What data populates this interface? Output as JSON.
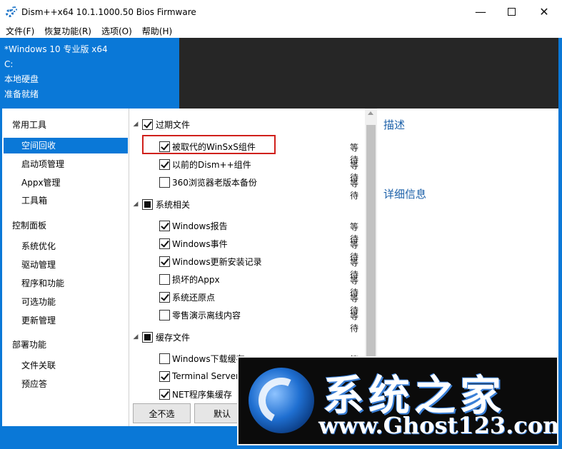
{
  "window": {
    "title": "Dism++x64 10.1.1000.50 Bios Firmware"
  },
  "menu": [
    "文件(F)",
    "恢复功能(R)",
    "选项(O)",
    "帮助(H)"
  ],
  "info": {
    "os": "*Windows 10 专业版 x64",
    "drive": "C:",
    "disk": "本地硬盘",
    "status": "准备就绪"
  },
  "sidebar": {
    "sections": [
      {
        "title": "常用工具",
        "items": [
          "空间回收",
          "启动项管理",
          "Appx管理",
          "工具箱"
        ]
      },
      {
        "title": "控制面板",
        "items": [
          "系统优化",
          "驱动管理",
          "程序和功能",
          "可选功能",
          "更新管理"
        ]
      },
      {
        "title": "部署功能",
        "items": [
          "文件关联",
          "预应答"
        ]
      }
    ],
    "selected": "空间回收"
  },
  "list": {
    "groups": [
      {
        "label": "过期文件",
        "state": "checked",
        "items": [
          {
            "label": "被取代的WinSxS组件",
            "checked": true,
            "status": "等待"
          },
          {
            "label": "以前的Dism++组件",
            "checked": true,
            "status": "等待"
          },
          {
            "label": "360浏览器老版本备份",
            "checked": false,
            "status": "等待"
          }
        ]
      },
      {
        "label": "系统相关",
        "state": "partial",
        "items": [
          {
            "label": "Windows报告",
            "checked": true,
            "status": "等待"
          },
          {
            "label": "Windows事件",
            "checked": true,
            "status": "等待"
          },
          {
            "label": "Windows更新安装记录",
            "checked": true,
            "status": "等待"
          },
          {
            "label": "损坏的Appx",
            "checked": false,
            "status": "等待"
          },
          {
            "label": "系统还原点",
            "checked": true,
            "status": "等待"
          },
          {
            "label": "零售演示离线内容",
            "checked": false,
            "status": "等待"
          }
        ]
      },
      {
        "label": "缓存文件",
        "state": "partial",
        "items": [
          {
            "label": "Windows下载缓存",
            "checked": false,
            "status": "等待"
          },
          {
            "label": "Terminal Server",
            "checked": true,
            "status": ""
          },
          {
            "label": "NET程序集缓存",
            "checked": true,
            "status": ""
          }
        ]
      }
    ]
  },
  "details": {
    "description_label": "描述",
    "details_label": "详细信息"
  },
  "buttons": {
    "deselect_all": "全不选",
    "default": "默认"
  },
  "watermark": {
    "title": "系统之家",
    "url": "www.Ghost123.com"
  },
  "colors": {
    "accent": "#0a78d7",
    "dark_panel": "#262626",
    "highlight_border": "#d0201b"
  }
}
